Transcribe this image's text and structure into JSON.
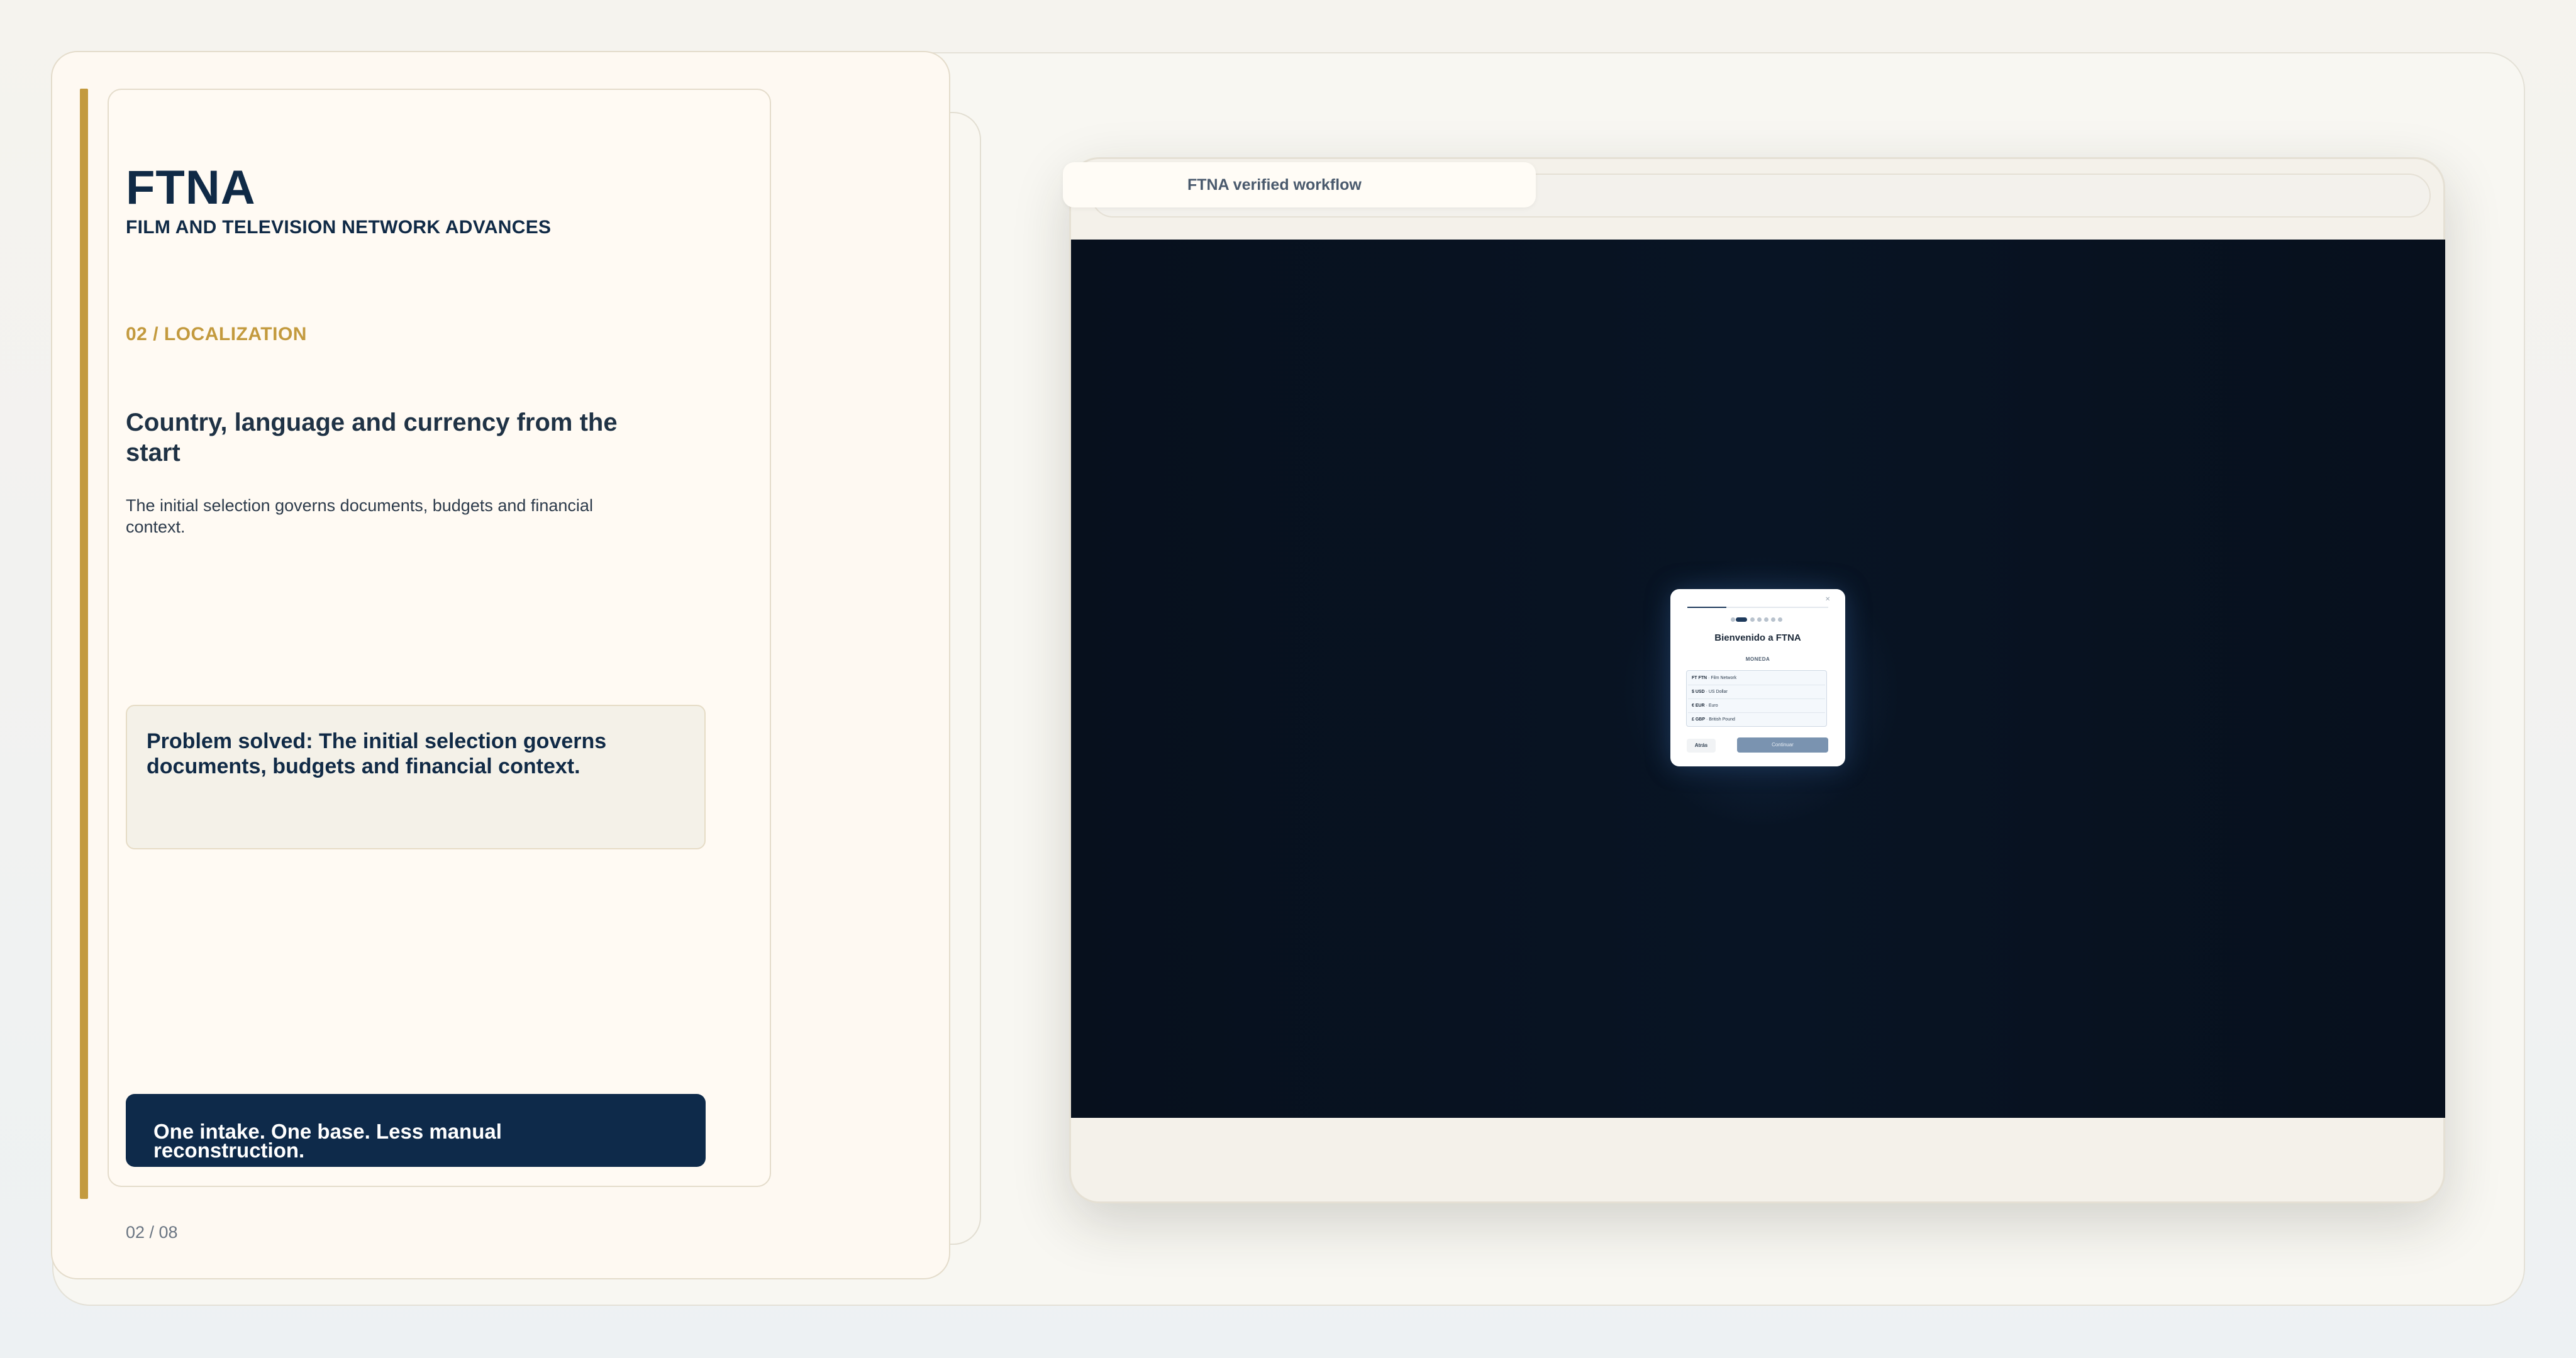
{
  "brand": {
    "name": "FTNA",
    "subtitle": "FILM AND TELEVISION NETWORK ADVANCES"
  },
  "slide": {
    "section_label": "02 / LOCALIZATION",
    "heading": "Country, language and currency from the start",
    "description": "The initial selection governs documents, budgets and financial context.",
    "problem": "Problem solved: The initial selection governs documents, budgets and financial context.",
    "cta": "One intake. One base. Less manual reconstruction.",
    "page_indicator": "02 / 08"
  },
  "browser": {
    "tab_title": "FTNA verified workflow"
  },
  "modal": {
    "title": "Bienvenido a FTNA",
    "section": "MONEDA",
    "close": "✕",
    "currencies": [
      {
        "code": "FT FTN",
        "name": "Film Network"
      },
      {
        "code": "$ USD",
        "name": "US Dollar"
      },
      {
        "code": "€ EUR",
        "name": "Euro"
      },
      {
        "code": "£ GBP",
        "name": "British Pound"
      }
    ],
    "back_label": "Atrás",
    "continue_label": "Continuar"
  },
  "colors": {
    "navy": "#102a46",
    "gold": "#c39a3e",
    "screen": "#07101d"
  }
}
